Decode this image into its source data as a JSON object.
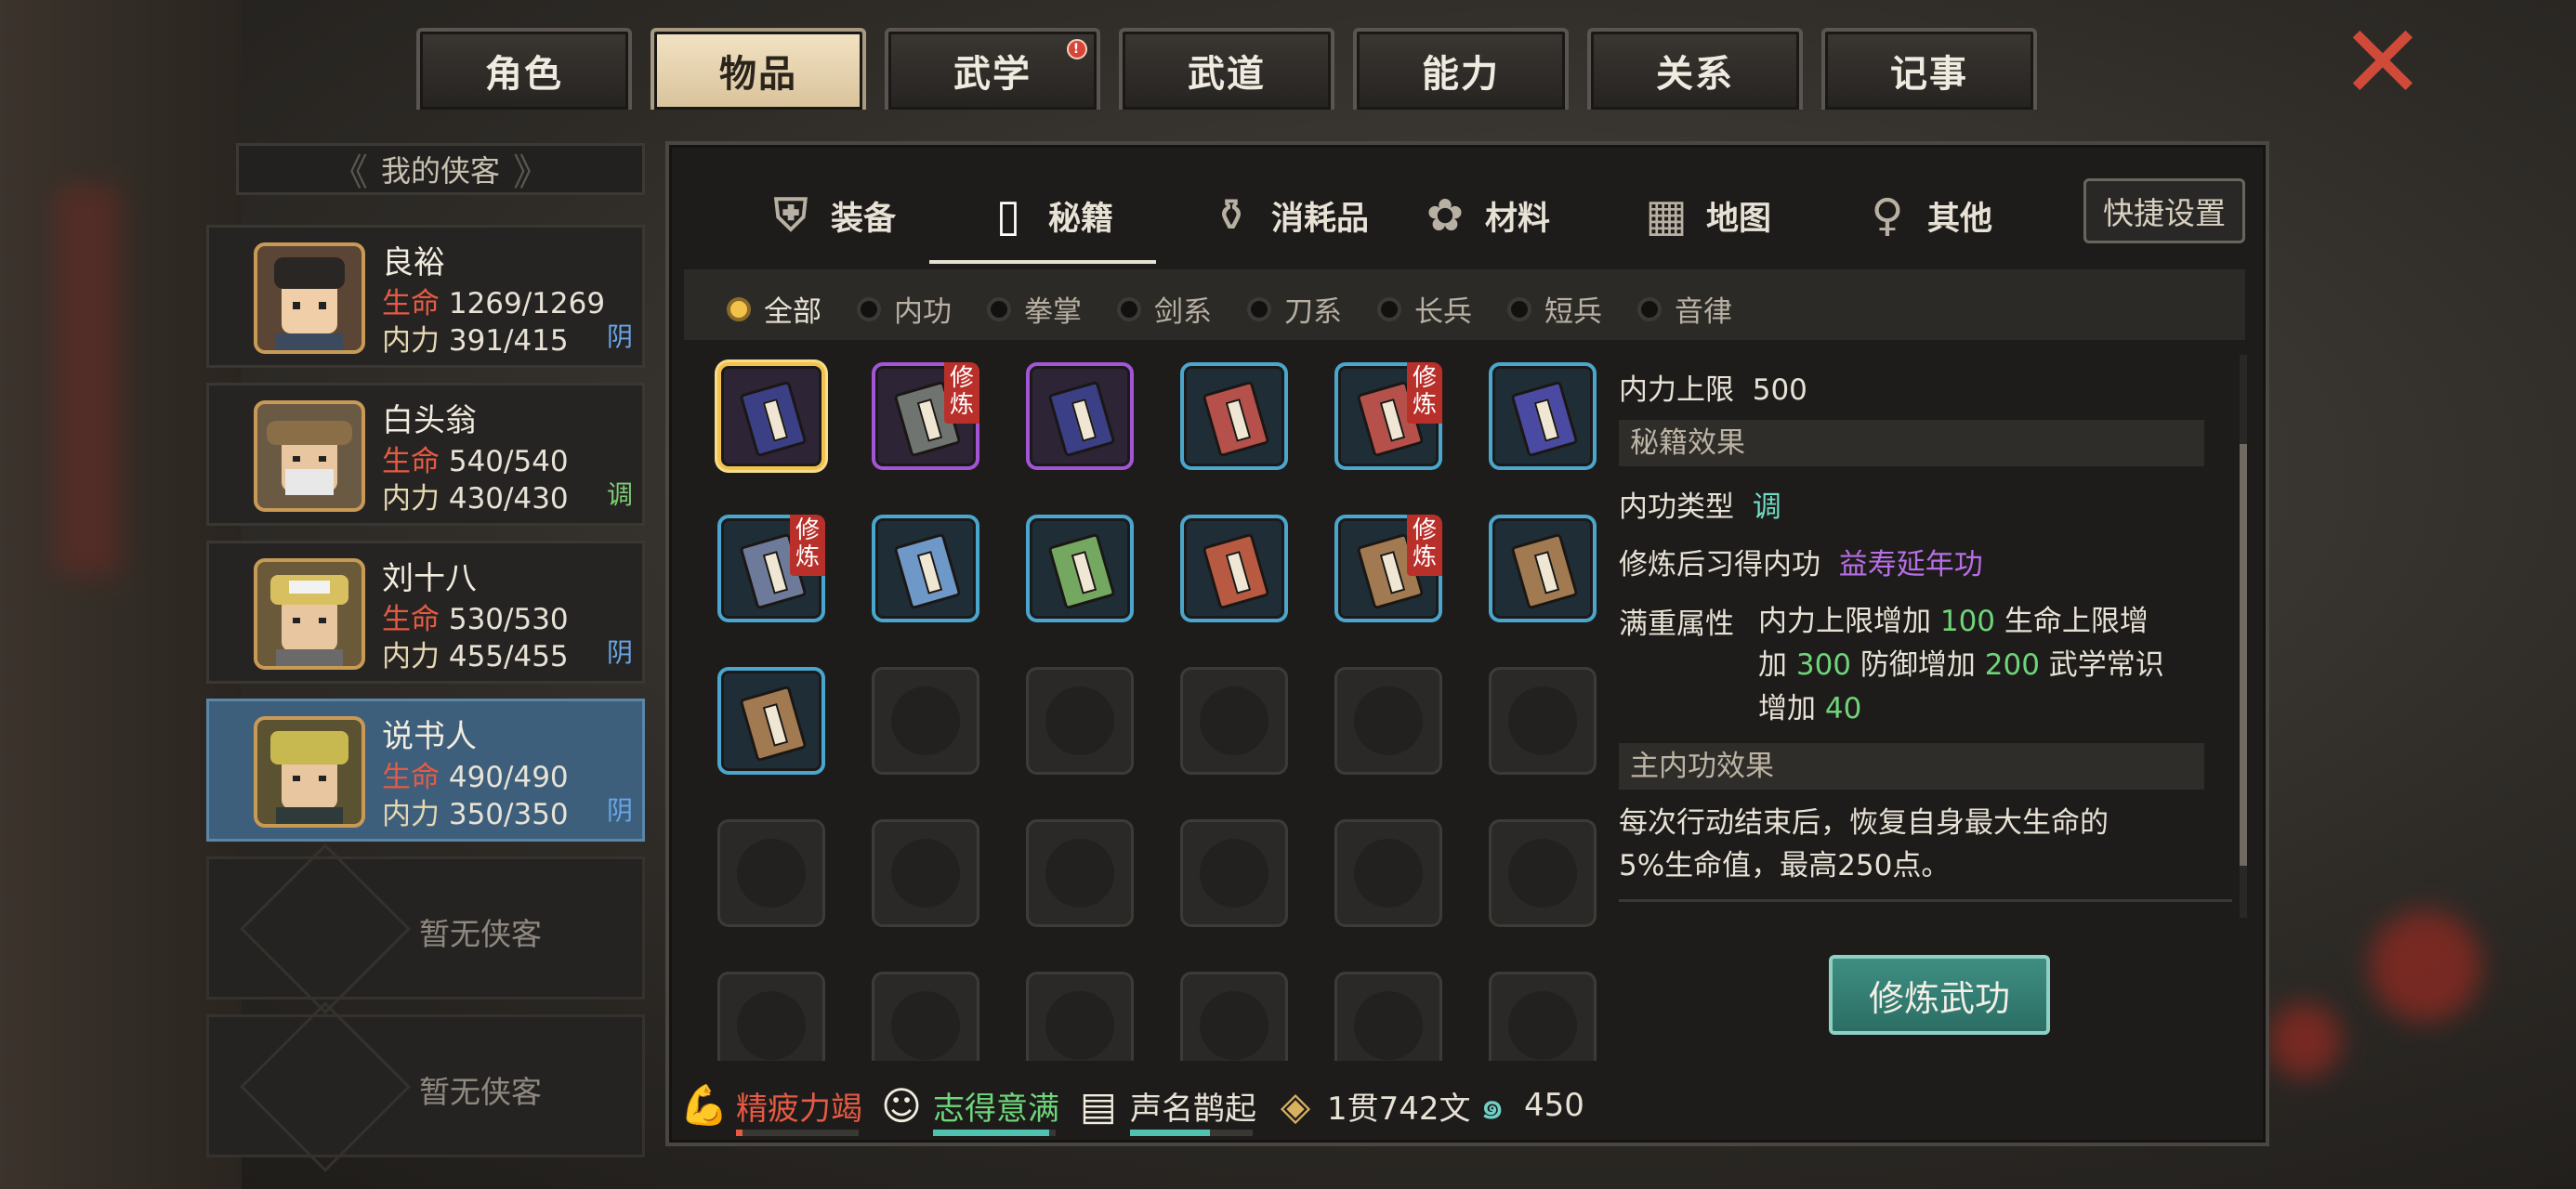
{
  "top_tabs": [
    {
      "label": "角色"
    },
    {
      "label": "物品",
      "active": true
    },
    {
      "label": "武学",
      "notify": "!"
    },
    {
      "label": "武道"
    },
    {
      "label": "能力"
    },
    {
      "label": "关系"
    },
    {
      "label": "记事"
    }
  ],
  "close_icon": "close-x-icon",
  "party": {
    "title": "我的侠客",
    "heroes": [
      {
        "name": "良裕",
        "hp_label": "生命",
        "hp": "1269/1269",
        "mp_label": "内力",
        "mp": "391/415",
        "tag": "阴"
      },
      {
        "name": "白头翁",
        "hp_label": "生命",
        "hp": "540/540",
        "mp_label": "内力",
        "mp": "430/430",
        "tag": "调"
      },
      {
        "name": "刘十八",
        "hp_label": "生命",
        "hp": "530/530",
        "mp_label": "内力",
        "mp": "455/455",
        "tag": "阴"
      },
      {
        "name": "说书人",
        "hp_label": "生命",
        "hp": "490/490",
        "mp_label": "内力",
        "mp": "350/350",
        "tag": "阴",
        "active": true
      }
    ],
    "empty_slots": [
      "暂无侠客",
      "暂无侠客"
    ]
  },
  "sub_tabs": [
    {
      "label": "装备",
      "icon": "armor-icon"
    },
    {
      "label": "秘籍",
      "icon": "scroll-book-icon",
      "active": true
    },
    {
      "label": "消耗品",
      "icon": "potion-icon"
    },
    {
      "label": "材料",
      "icon": "herb-icon"
    },
    {
      "label": "地图",
      "icon": "map-icon"
    },
    {
      "label": "其他",
      "icon": "misc-icon"
    }
  ],
  "quick_settings_label": "快捷设置",
  "filters": [
    "全部",
    "内功",
    "拳掌",
    "剑系",
    "刀系",
    "长兵",
    "短兵",
    "音律"
  ],
  "active_filter": "全部",
  "items": [
    {
      "color": "#3b3f86",
      "frame": "selected",
      "practice": false
    },
    {
      "color": "#6f7470",
      "frame": "purple",
      "practice": true
    },
    {
      "color": "#3b3f86",
      "frame": "purple",
      "practice": false
    },
    {
      "color": "#b5504a",
      "frame": "blue",
      "practice": false
    },
    {
      "color": "#b5504a",
      "frame": "blue",
      "practice": true
    },
    {
      "color": "#4a4aa2",
      "frame": "blue",
      "practice": false
    },
    {
      "color": "#6d7a9a",
      "frame": "blue",
      "practice": true
    },
    {
      "color": "#6e98c8",
      "frame": "blue",
      "practice": false
    },
    {
      "color": "#74a860",
      "frame": "blue",
      "practice": false
    },
    {
      "color": "#b85a42",
      "frame": "blue",
      "practice": false
    },
    {
      "color": "#a27a52",
      "frame": "blue",
      "practice": true
    },
    {
      "color": "#a27a52",
      "frame": "blue",
      "practice": false
    },
    {
      "color": "#a27a52",
      "frame": "blue",
      "practice": false
    }
  ],
  "practice_tag": "修炼",
  "detail": {
    "mp_cap_label": "内力上限",
    "mp_cap_value": "500",
    "section_effect": "秘籍效果",
    "type_label": "内功类型",
    "type_value": "调",
    "learn_label": "修炼后习得内功",
    "learn_value": "益寿延年功",
    "full_label": "满重属性",
    "full_t1": "内力上限增加",
    "full_v1": "100",
    "full_t2": "生命上限增",
    "full_t3": "加",
    "full_v2": "300",
    "full_t4": "防御增加",
    "full_v3": "200",
    "full_t5": "武学常识",
    "full_t6": "增加",
    "full_v4": "40",
    "section_main": "主内功效果",
    "main_line1": "每次行动结束后，恢复自身最大生命的",
    "main_line2": "5%生命值，最高250点。"
  },
  "practice_button": "修炼武功",
  "status": [
    {
      "text": "精疲力竭",
      "color": "#e65a44",
      "icon": "muscle-arm-icon",
      "fill": 0.05,
      "bar": "#e65a44"
    },
    {
      "text": "志得意满",
      "color": "#6ed67a",
      "icon": "smiley-face-icon",
      "fill": 0.95,
      "bar": "#4fc2b0"
    },
    {
      "text": "声名鹊起",
      "color": "#e8e2d6",
      "icon": "reputation-scroll-icon",
      "fill": 0.65,
      "bar": "#4fc2b0"
    },
    {
      "text": "1贯742文",
      "color": "#e8e2d6",
      "icon": "copper-coin-icon"
    },
    {
      "text": "450",
      "color": "#e8e2d6",
      "icon": "jade-swirl-icon"
    }
  ]
}
